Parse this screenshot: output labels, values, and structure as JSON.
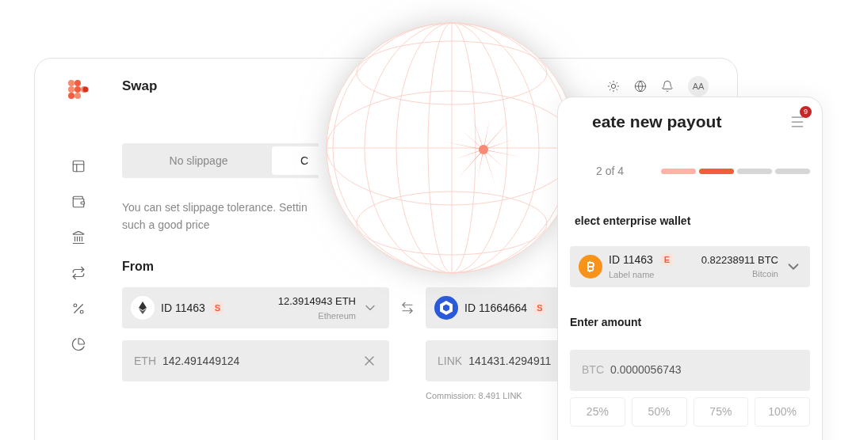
{
  "swap": {
    "title": "Swap",
    "avatar": "AA",
    "slippage_tabs": [
      {
        "label": "No slippage",
        "selected": false
      },
      {
        "label": "C",
        "selected": true
      }
    ],
    "hint_lines": [
      "You can set slippage tolerance. Settin",
      "such a good price"
    ],
    "from_label": "From",
    "from_wallet": {
      "id": "ID 11463",
      "badge": "S",
      "balance": "12.3914943 ETH",
      "network": "Ethereum"
    },
    "from_amount": {
      "currency": "ETH",
      "value": "142.491449124"
    },
    "to_wallet": {
      "id": "ID 11664664",
      "badge": "S"
    },
    "to_amount": {
      "currency": "LINK",
      "value": "141431.4294911"
    },
    "commission": "Commission: 8.491 LINK"
  },
  "payout": {
    "title": "eate new payout",
    "menu_badge": "9",
    "step": "2 of 4",
    "steps": [
      {
        "done": true,
        "current": false
      },
      {
        "done": false,
        "current": true
      },
      {
        "done": false,
        "current": false
      },
      {
        "done": false,
        "current": false
      }
    ],
    "wallet_label": "elect enterprise wallet",
    "wallet": {
      "id": "ID 11463",
      "badge": "E",
      "label": "Label name",
      "balance": "0.82238911 BTC",
      "network": "Bitcoin"
    },
    "amount_label": "Enter amount",
    "amount": {
      "currency": "BTC",
      "value": "0.0000056743"
    },
    "presets": [
      "25%",
      "50%",
      "75%",
      "100%"
    ]
  }
}
